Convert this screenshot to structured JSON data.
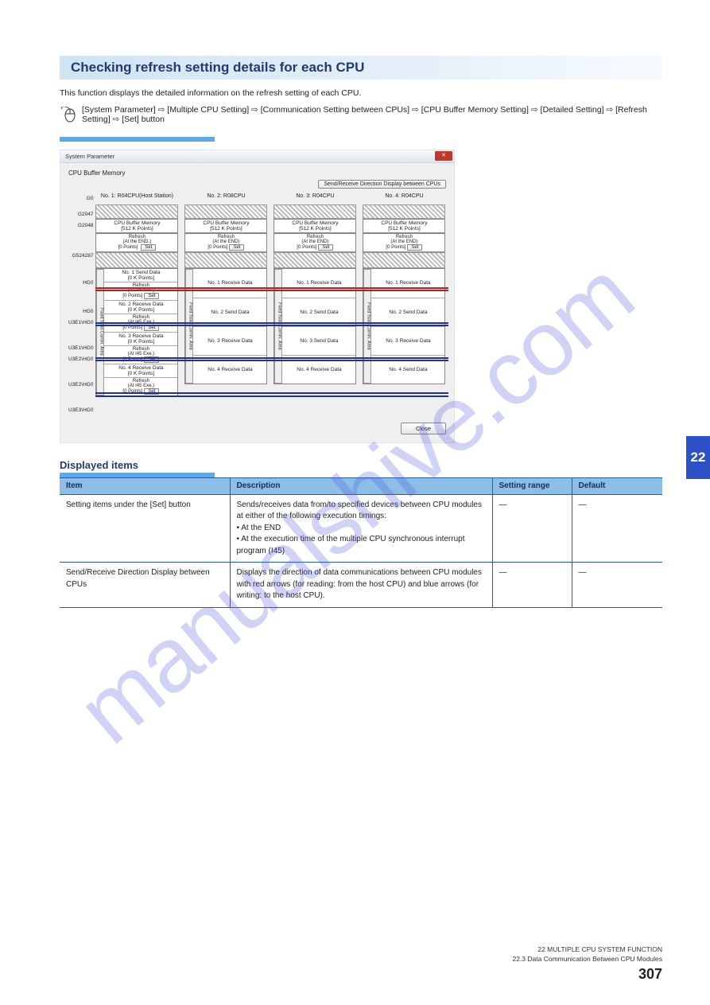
{
  "section": {
    "title": "Checking refresh setting details for each CPU",
    "intro": "This function displays the detailed information on the refresh setting of each CPU.",
    "nav": "[System Parameter] ⇨ [Multiple CPU Setting] ⇨ [Communication Setting between CPUs] ⇨ [CPU Buffer Memory Setting] ⇨ [Detailed Setting] ⇨ [Refresh Setting] ⇨ [Set] button"
  },
  "dialog": {
    "title": "System Parameter",
    "subtitle": "CPU Buffer Memory",
    "top_button": "Send/Receive Direction Display between CPUs",
    "close_x": "✕",
    "close_btn": "Close",
    "left_labels": [
      "G0",
      "G2047",
      "G2048",
      "G524287",
      "HG0",
      "HG0",
      "U3E1\\HG0",
      "U3E1\\HG0",
      "U3E2\\HG0",
      "U3E2\\HG0",
      "U3E3\\HG0"
    ],
    "cols": [
      {
        "head": "No. 1: R04CPU(Host Station)",
        "mem": "CPU Buffer Memory\n[512 K Points]",
        "ref": "Refresh\n(At the END.)\n[0 Points]",
        "cells": [
          "No. 1 Send Data\n[0 K Points]",
          "Refresh\n(At I45 Exe.)\n[0 Points]",
          "No. 2 Receive Data\n[0 K Points]",
          "Refresh\n(At I45 Exe.)\n[0 Points]",
          "No. 3 Receive Data\n[0 K Points]",
          "Refresh\n(At I45 Exe.)\n[0 Points]",
          "No. 4 Receive Data\n[0 K Points]",
          "Refresh\n(At I45 Exe.)\n[0 Points]"
        ]
      },
      {
        "head": "No. 2: R08CPU",
        "mem": "CPU Buffer Memory\n[512 K Points]",
        "ref": "Refresh\n(At the END)\n[0 Points]",
        "cells": [
          "No. 1 Receive Data",
          "",
          "No. 2 Send Data",
          "",
          "No. 3 Receive Data",
          "",
          "No. 4 Receive Data",
          ""
        ]
      },
      {
        "head": "No. 3: R04CPU",
        "mem": "CPU Buffer Memory\n[512 K Points]",
        "ref": "Refresh\n(At the END)\n[0 Points]",
        "cells": [
          "No. 1 Receive Data",
          "",
          "No. 2 Send Data",
          "",
          "No. 3 Send Data",
          "",
          "No. 4 Receive Data",
          ""
        ]
      },
      {
        "head": "No. 4: R04CPU",
        "mem": "CPU Buffer Memory\n[512 K Points]",
        "ref": "Refresh\n(At the END)\n[0 Points]",
        "cells": [
          "No. 1 Receive Data",
          "",
          "No. 2 Send Data",
          "",
          "No. 3 Receive Data",
          "",
          "No. 4 Send Data",
          ""
        ]
      }
    ],
    "fixed_label": "Fixed Scan Comm. Area",
    "set_label": "Set"
  },
  "displayed": {
    "title": "Displayed items",
    "headers": [
      "Item",
      "Description",
      "Setting range",
      "Default"
    ],
    "rows": [
      {
        "item": "Setting items under the [Set] button",
        "desc": "Sends/receives data from/to specified devices between CPU modules at either of the following execution timings:\n• At the END\n• At the execution time of the multiple CPU synchronous interrupt program (I45)",
        "range": "—",
        "def": "—"
      },
      {
        "item": "Send/Receive Direction Display between CPUs",
        "desc": "Displays the direction of data communications between CPU modules with red arrows (for reading: from the host CPU) and blue arrows (for writing: to the host CPU).",
        "range": "—",
        "def": "—"
      }
    ]
  },
  "footer": {
    "chapter": "22  MULTIPLE CPU SYSTEM FUNCTION",
    "sub": "22.3  Data Communication Between CPU Modules",
    "page": "307"
  },
  "side_tab": "22"
}
